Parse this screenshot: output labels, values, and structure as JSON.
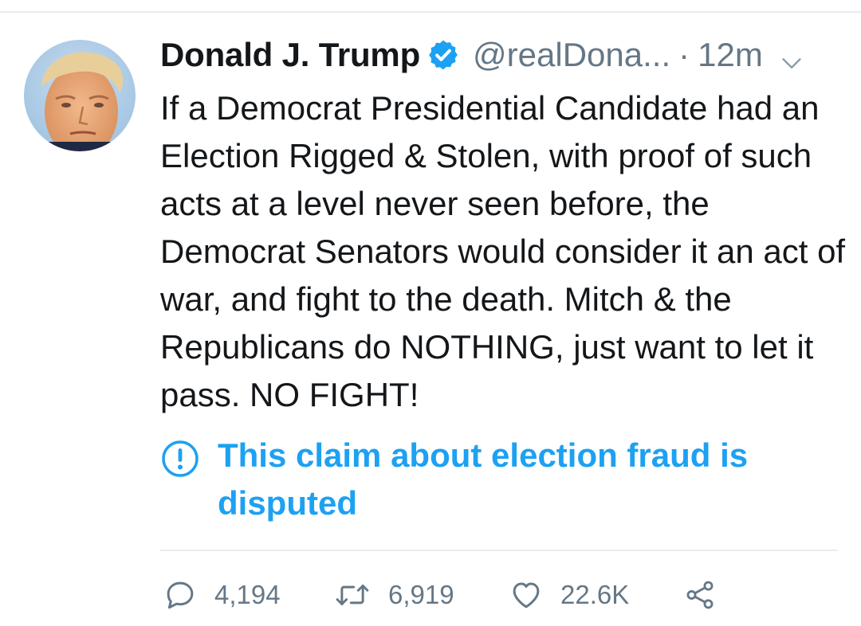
{
  "tweet": {
    "display_name": "Donald J. Trump",
    "handle": "@realDona...",
    "separator": "·",
    "timestamp": "12m",
    "text": "If a Democrat Presidential Candidate had an Election Rigged & Stolen, with proof of such acts at a level never seen before, the Democrat Senators would consider it an act of war, and fight to the death. Mitch & the Republicans do NOTHING, just want to let it pass. NO FIGHT!",
    "notice": "This claim about election fraud is disputed",
    "replies": "4,194",
    "retweets": "6,919",
    "likes": "22.6K"
  },
  "icons": {
    "verified": "verified-badge-icon",
    "menu": "chevron-down-icon",
    "notice": "exclamation-circle-icon",
    "reply": "reply-icon",
    "retweet": "retweet-icon",
    "like": "heart-icon",
    "share": "share-icon"
  },
  "colors": {
    "accent": "#1da1f2",
    "text": "#14171a",
    "secondary": "#657786",
    "divider": "#e6ecf0"
  }
}
